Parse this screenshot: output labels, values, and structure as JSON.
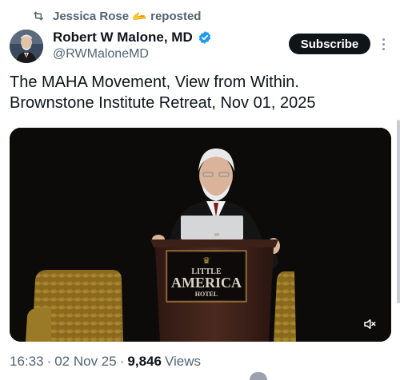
{
  "repost": {
    "icon": "repost-icon",
    "user": "Jessica Rose",
    "emoji": "🫴",
    "label": "reposted"
  },
  "author": {
    "name": "Robert W Malone, MD",
    "handle": "@RWMaloneMD",
    "verified_icon": "verified-badge-icon",
    "verified_color": "#1d9bf0"
  },
  "subscribe_label": "Subscribe",
  "post": {
    "line1": "The MAHA Movement, View from Within.",
    "line2": "Brownstone Institute Retreat, Nov 01, 2025"
  },
  "media": {
    "podium_logo_line1": "LITTLE",
    "podium_logo_line2": "AMERICA",
    "podium_logo_line3": "HOTEL",
    "mute_icon": "speaker-muted-icon"
  },
  "meta": {
    "time": "16:33",
    "separator": "·",
    "date": "02 Nov 25",
    "views_count": "9,846",
    "views_label": "Views"
  },
  "colors": {
    "text_primary": "#0f1419",
    "text_secondary": "#536471",
    "subscribe_bg": "#0f1419",
    "accent_blue": "#1d9bf0"
  }
}
